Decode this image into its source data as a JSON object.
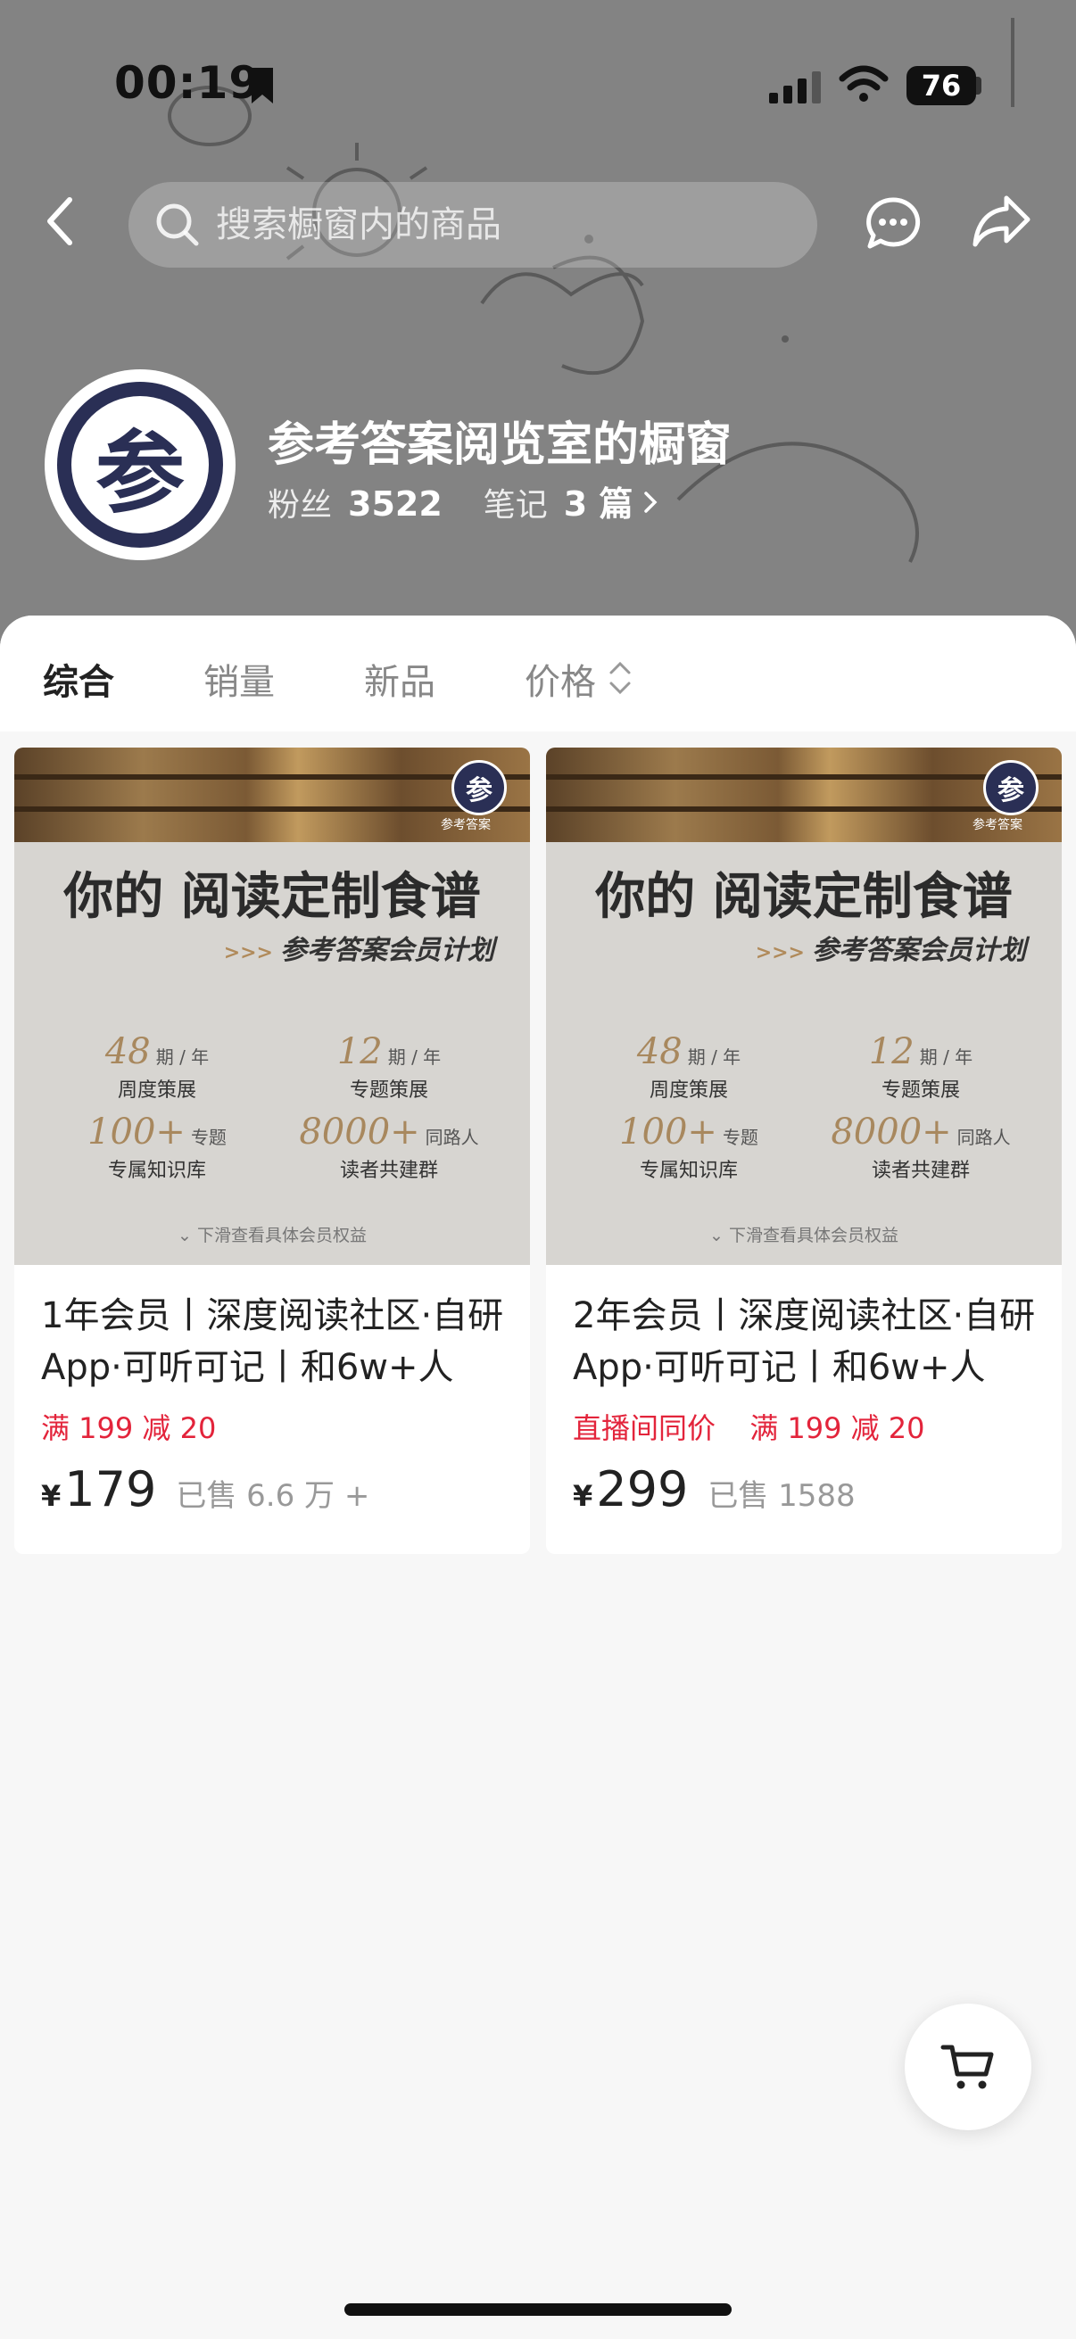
{
  "status_bar": {
    "time": "00:19",
    "battery": "76"
  },
  "search": {
    "placeholder": "搜索橱窗内的商品"
  },
  "shop": {
    "name": "参考答案阅览室的橱窗",
    "avatar_char": "参",
    "fans_label": "粉丝",
    "fans_count": "3522",
    "notes_label": "笔记",
    "notes_count": "3 篇"
  },
  "tabs": [
    "综合",
    "销量",
    "新品",
    "价格"
  ],
  "poster": {
    "badge_char": "参",
    "badge_text": "参考答案",
    "title": "你的 阅读定制食谱",
    "subtitle_arrows": ">>>",
    "subtitle": "参考答案会员计划",
    "stats": [
      {
        "value": "48",
        "unit": "期 / 年",
        "label": "周度策展"
      },
      {
        "value": "12",
        "unit": "期 / 年",
        "label": "专题策展"
      },
      {
        "value": "100+",
        "unit": "专题",
        "label": "专属知识库"
      },
      {
        "value": "8000+",
        "unit": "同路人",
        "label": "读者共建群"
      }
    ],
    "footer": "下滑查看具体会员权益"
  },
  "products": [
    {
      "title": "1年会员丨深度阅读社区·自研App·可听可记丨和6w+人",
      "promos": [
        "满 199 减 20"
      ],
      "currency": "¥",
      "price": "179",
      "sold": "已售 6.6 万 +"
    },
    {
      "title": "2年会员丨深度阅读社区·自研App·可听可记丨和6w+人",
      "promos": [
        "直播间同价",
        "满 199 减 20"
      ],
      "currency": "¥",
      "price": "299",
      "sold": "已售 1588"
    }
  ],
  "colors": {
    "promo_red": "#e3243b",
    "header_gray": "#838383",
    "avatar_navy": "#2a2f55"
  }
}
